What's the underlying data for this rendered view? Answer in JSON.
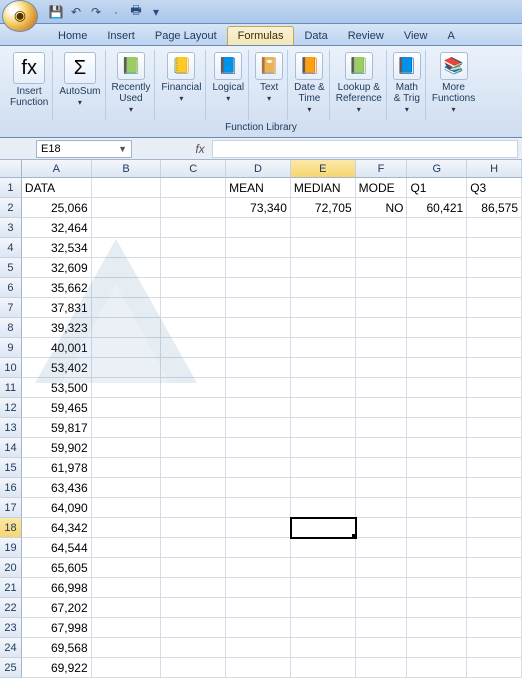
{
  "qat": {
    "save": "💾",
    "undo": "↶",
    "redo": "↷",
    "print": "🖶",
    "more": "▾"
  },
  "tabs": {
    "home": "Home",
    "insert": "Insert",
    "pagelayout": "Page Layout",
    "formulas": "Formulas",
    "data": "Data",
    "review": "Review",
    "view": "View",
    "addins": "A"
  },
  "ribbon": {
    "insert_function": "Insert\nFunction",
    "autosum": "AutoSum",
    "recently": "Recently\nUsed",
    "financial": "Financial",
    "logical": "Logical",
    "text": "Text",
    "datetime": "Date &\nTime",
    "lookup": "Lookup &\nReference",
    "math": "Math\n& Trig",
    "more": "More\nFunctions",
    "group_title": "Function Library",
    "fx": "fx",
    "sigma": "Σ",
    "book": "📗",
    "fin": "📒",
    "logi": "📘",
    "txt": "📔",
    "dt": "📙",
    "look": "📗",
    "mth": "📘",
    "mor": "📚"
  },
  "namebox": "E18",
  "fx_label": "fx",
  "columns": [
    "A",
    "B",
    "C",
    "D",
    "E",
    "F",
    "G",
    "H"
  ],
  "headers_row": {
    "A": "DATA",
    "D": "MEAN",
    "E": "MEDIAN",
    "F": "MODE",
    "G": "Q1",
    "H": "Q3"
  },
  "stats_row": {
    "D": "73,340",
    "E": "72,705",
    "F": "NO",
    "G": "60,421",
    "H": "86,575"
  },
  "data_col": [
    "25,066",
    "32,464",
    "32,534",
    "32,609",
    "35,662",
    "37,831",
    "39,323",
    "40,001",
    "53,402",
    "53,500",
    "59,465",
    "59,817",
    "59,902",
    "61,978",
    "63,436",
    "64,090",
    "64,342",
    "64,544",
    "65,605",
    "66,998",
    "67,202",
    "67,998",
    "69,568",
    "69,922"
  ],
  "selected": {
    "col": "E",
    "row": 18
  }
}
